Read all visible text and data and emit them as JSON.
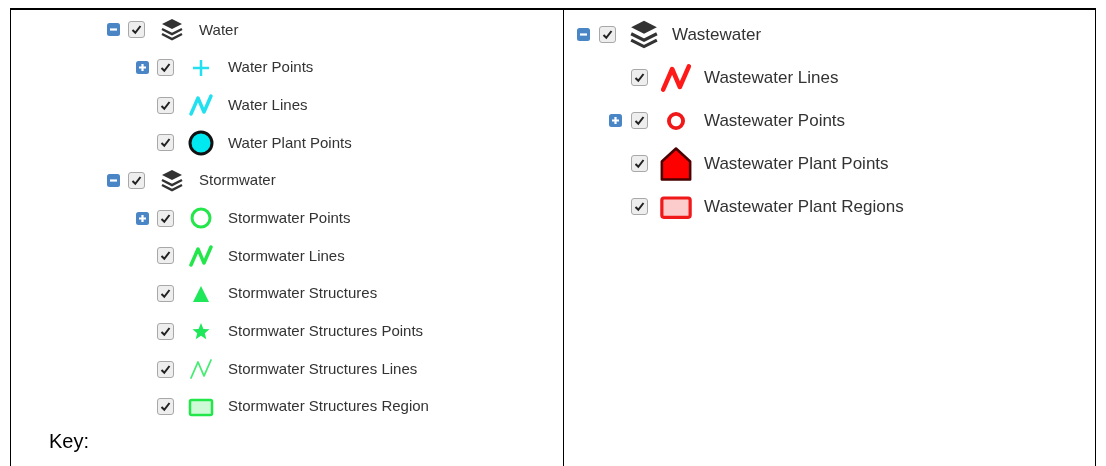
{
  "panels": [
    {
      "tree": [
        {
          "label": "Water",
          "expanded": true,
          "checked": true,
          "kind": "layers",
          "color": "#333333",
          "children": [
            {
              "label": "Water Points",
              "expanded": false,
              "checked": true,
              "kind": "cross",
              "color": "#22e0f0"
            },
            {
              "label": "Water Lines",
              "checked": true,
              "kind": "zigzag",
              "color": "#22e0f0"
            },
            {
              "label": "Water Plant Points",
              "checked": true,
              "kind": "dot",
              "color": "#00e8f0"
            }
          ]
        },
        {
          "label": "Stormwater",
          "expanded": true,
          "checked": true,
          "kind": "layers",
          "color": "#333333",
          "children": [
            {
              "label": "Stormwater Points",
              "expanded": false,
              "checked": true,
              "kind": "ring",
              "color": "#22e64a"
            },
            {
              "label": "Stormwater Lines",
              "checked": true,
              "kind": "zigzag",
              "color": "#22e64a"
            },
            {
              "label": "Stormwater Structures",
              "checked": true,
              "kind": "triangle",
              "color": "#1ee85a"
            },
            {
              "label": "Stormwater Structures Points",
              "checked": true,
              "kind": "star",
              "color": "#1ee85a"
            },
            {
              "label": "Stormwater Structures Lines",
              "checked": true,
              "kind": "thin",
              "color": "#44ec70"
            },
            {
              "label": "Stormwater Structures Region",
              "checked": true,
              "kind": "region",
              "color": "#22e64a"
            }
          ]
        }
      ]
    },
    {
      "tree": [
        {
          "label": "Wastewater",
          "expanded": true,
          "checked": true,
          "kind": "layers",
          "color": "#333333",
          "children": [
            {
              "label": "Wastewater Lines",
              "checked": true,
              "kind": "zigzag",
              "color": "#ff1a1a"
            },
            {
              "label": "Wastewater Points",
              "expanded": false,
              "checked": true,
              "kind": "small",
              "color": "#f01818"
            },
            {
              "label": "Wastewater Plant Points",
              "checked": true,
              "kind": "house",
              "color": "#ff0000"
            },
            {
              "label": "Wastewater Plant Regions",
              "checked": true,
              "kind": "region",
              "color": "#f01818"
            }
          ]
        }
      ]
    }
  ],
  "caption": "Key:"
}
